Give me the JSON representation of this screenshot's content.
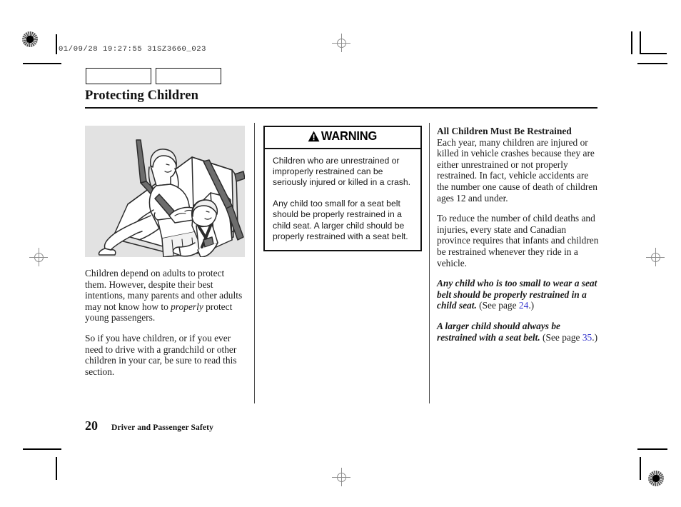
{
  "scan": {
    "stamp": "01/09/28 19:27:55 31SZ3660_023"
  },
  "page": {
    "title": "Protecting Children",
    "number": "20",
    "section": "Driver and Passenger Safety"
  },
  "tabs": [
    {
      "label": ""
    },
    {
      "label": ""
    }
  ],
  "figure": {
    "caption": "",
    "alt_name": "rear-seat-child-restraint-illustration",
    "background_color": "#e2e2e2"
  },
  "left_column": {
    "paragraphs": [
      {
        "before_italic": "Children depend on adults to protect them. However, despite their best intentions, many parents and other adults may not know how to ",
        "italic": "properly",
        "after_italic": " protect young passengers."
      },
      {
        "before_italic": "So if you have children, or if you ever need to drive with a grandchild or other children in your car, be sure to read this section.",
        "italic": "",
        "after_italic": ""
      }
    ]
  },
  "warning": {
    "heading": "WARNING",
    "icon": "warning-triangle-icon",
    "paragraphs": [
      "Children who are unrestrained or improperly restrained can be seriously injured or killed in a crash.",
      "Any child too small for a seat belt should be properly restrained in a child seat. A larger child should be properly restrained with a seat belt."
    ]
  },
  "right_column": {
    "heading": "All Children Must Be Restrained",
    "paragraphs": [
      "Each year, many children are injured or killed in vehicle crashes because they are either unrestrained or not properly restrained. In fact, vehicle accidents are the number one cause of death of children ages 12 and under.",
      "To reduce the number of child deaths and injuries, every state and Canadian province requires that infants and children be restrained whenever they ride in a vehicle."
    ],
    "references": [
      {
        "bold_italic": "Any child who is too small to wear a seat belt should be properly restrained in a child seat.",
        "see_page_prefix": " (See page ",
        "page": "24",
        "see_page_suffix": ".)"
      },
      {
        "bold_italic": "A larger child should always be restrained with a seat belt.",
        "see_page_prefix": " (See page ",
        "page": "35",
        "see_page_suffix": ".)"
      }
    ],
    "link_color": "#3333cc"
  }
}
